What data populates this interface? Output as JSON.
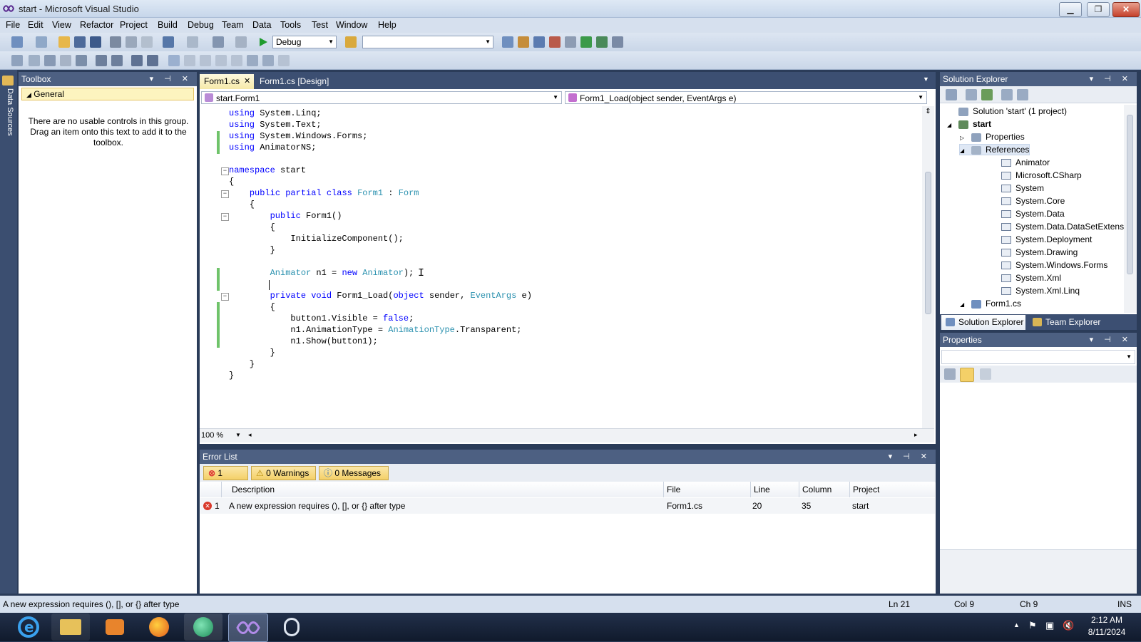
{
  "window": {
    "title": "start - Microsoft Visual Studio"
  },
  "menu": [
    "File",
    "Edit",
    "View",
    "Refactor",
    "Project",
    "Build",
    "Debug",
    "Team",
    "Data",
    "Tools",
    "Test",
    "Window",
    "Help"
  ],
  "toolbar": {
    "config": "Debug",
    "platform": ""
  },
  "sidebar": {
    "label": "Data Sources"
  },
  "toolbox": {
    "title": "Toolbox",
    "group": "General",
    "empty_text": "There are no usable controls in this group. Drag an item onto this text to add it to the toolbox."
  },
  "editor": {
    "tabs": [
      {
        "label": "Form1.cs",
        "active": true
      },
      {
        "label": "Form1.cs [Design]",
        "active": false
      }
    ],
    "class_dropdown": "start.Form1",
    "member_dropdown": "Form1_Load(object sender, EventArgs e)",
    "zoom": "100 %",
    "lines": [
      [
        [
          "kw",
          "using"
        ],
        [
          "t",
          " System.Linq;"
        ]
      ],
      [
        [
          "kw",
          "using"
        ],
        [
          "t",
          " System.Text;"
        ]
      ],
      [
        [
          "kw",
          "using"
        ],
        [
          "t",
          " System.Windows.Forms;"
        ]
      ],
      [
        [
          "kw",
          "using"
        ],
        [
          "t",
          " AnimatorNS;"
        ]
      ],
      [],
      [
        [
          "kw",
          "namespace"
        ],
        [
          "t",
          " start"
        ]
      ],
      [
        [
          "t",
          "{"
        ]
      ],
      [
        [
          "t",
          "    "
        ],
        [
          "kw",
          "public"
        ],
        [
          "t",
          " "
        ],
        [
          "kw",
          "partial"
        ],
        [
          "t",
          " "
        ],
        [
          "kw",
          "class"
        ],
        [
          "t",
          " "
        ],
        [
          "ty",
          "Form1"
        ],
        [
          "t",
          " : "
        ],
        [
          "ty",
          "Form"
        ]
      ],
      [
        [
          "t",
          "    {"
        ]
      ],
      [
        [
          "t",
          "        "
        ],
        [
          "kw",
          "public"
        ],
        [
          "t",
          " Form1()"
        ]
      ],
      [
        [
          "t",
          "        {"
        ]
      ],
      [
        [
          "t",
          "            InitializeComponent();"
        ]
      ],
      [
        [
          "t",
          "        }"
        ]
      ],
      [],
      [
        [
          "t",
          "        "
        ],
        [
          "ty",
          "Animator"
        ],
        [
          "t",
          " n1 = "
        ],
        [
          "kw",
          "new"
        ],
        [
          "t",
          " "
        ],
        [
          "ty",
          "Animator"
        ],
        [
          "t",
          ");"
        ]
      ],
      [
        [
          "t",
          "        "
        ]
      ],
      [
        [
          "t",
          "        "
        ],
        [
          "kw",
          "private"
        ],
        [
          "t",
          " "
        ],
        [
          "kw",
          "void"
        ],
        [
          "t",
          " Form1_Load("
        ],
        [
          "kw",
          "object"
        ],
        [
          "t",
          " sender, "
        ],
        [
          "ty",
          "EventArgs"
        ],
        [
          "t",
          " e)"
        ]
      ],
      [
        [
          "t",
          "        {"
        ]
      ],
      [
        [
          "t",
          "            button1.Visible = "
        ],
        [
          "kw",
          "false"
        ],
        [
          "t",
          ";"
        ]
      ],
      [
        [
          "t",
          "            n1.AnimationType = "
        ],
        [
          "ty",
          "AnimationType"
        ],
        [
          "t",
          ".Transparent;"
        ]
      ],
      [
        [
          "t",
          "            n1.Show(button1);"
        ]
      ],
      [
        [
          "t",
          "        }"
        ]
      ],
      [
        [
          "t",
          "    }"
        ]
      ],
      [
        [
          "t",
          "}"
        ]
      ]
    ]
  },
  "solution_explorer": {
    "title": "Solution Explorer",
    "solution": "Solution 'start' (1 project)",
    "project": "start",
    "properties": "Properties",
    "references_label": "References",
    "references": [
      "Animator",
      "Microsoft.CSharp",
      "System",
      "System.Core",
      "System.Data",
      "System.Data.DataSetExtensions",
      "System.Deployment",
      "System.Drawing",
      "System.Windows.Forms",
      "System.Xml",
      "System.Xml.Linq"
    ],
    "file": "Form1.cs",
    "tabs": [
      "Solution Explorer",
      "Team Explorer"
    ]
  },
  "properties_panel": {
    "title": "Properties"
  },
  "error_list": {
    "title": "Error List",
    "errors_tab": "1 Error",
    "warnings_tab": "0 Warnings",
    "messages_tab": "0 Messages",
    "columns": [
      "Description",
      "File",
      "Line",
      "Column",
      "Project"
    ],
    "rows": [
      {
        "num": "1",
        "description": "A new expression requires (), [], or {} after type",
        "file": "Form1.cs",
        "line": "20",
        "column": "35",
        "project": "start"
      }
    ]
  },
  "status": {
    "message": "A new expression requires (), [], or {} after type",
    "ln": "Ln 21",
    "col": "Col 9",
    "ch": "Ch 9",
    "ins": "INS"
  },
  "taskbar": {
    "time": "2:12 AM",
    "date": "8/11/2024"
  }
}
